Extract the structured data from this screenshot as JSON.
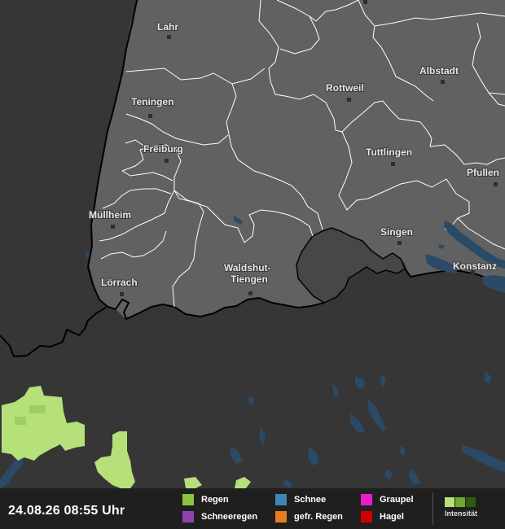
{
  "cities": [
    {
      "name": "Lahr"
    },
    {
      "name": "Teningen"
    },
    {
      "name": "Freiburg"
    },
    {
      "name": "Müllheim"
    },
    {
      "name": "Lörrach"
    },
    {
      "name": "Rottweil"
    },
    {
      "name": "Albstadt"
    },
    {
      "name": "Tuttlingen"
    },
    {
      "name": "Pfullen"
    },
    {
      "name": "Singen"
    },
    {
      "name": "Konstanz"
    },
    {
      "name_line1": "Waldshut-",
      "name_line2": "Tiengen"
    }
  ],
  "legend": {
    "timestamp": "24.08.26 08:55 Uhr",
    "items": [
      {
        "label": "Regen",
        "color": "#8cc63f"
      },
      {
        "label": "Schneeregen",
        "color": "#8e44ad"
      },
      {
        "label": "Schnee",
        "color": "#3f85b5"
      },
      {
        "label": "gefr. Regen",
        "color": "#e67e22"
      },
      {
        "label": "Graupel",
        "color": "#e91ec9"
      },
      {
        "label": "Hagel",
        "color": "#cc0000"
      }
    ],
    "intensity_label": "Intensität",
    "intensity_colors": [
      "#b5e07a",
      "#6fa830",
      "#2f5a10"
    ]
  },
  "map_colors": {
    "background": "#363636",
    "germany_land": "#616161",
    "highlight_district": "#474747",
    "water": "#2b4a66",
    "border": "#ffffff",
    "country_border": "#000000",
    "precip_light": "#b5e07a",
    "precip_dark": "#4f6b3a"
  }
}
